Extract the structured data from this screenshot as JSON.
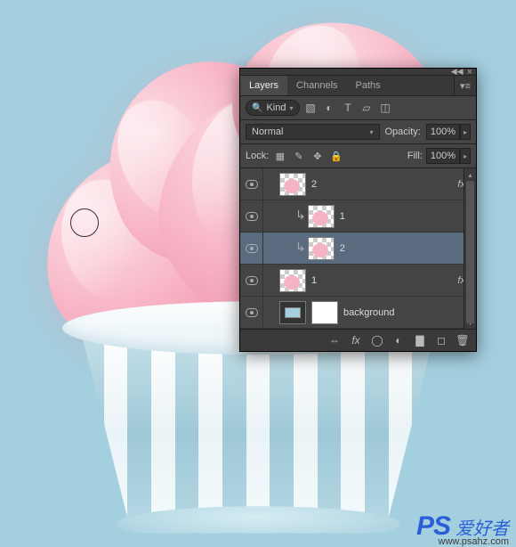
{
  "panel": {
    "tabs": [
      "Layers",
      "Channels",
      "Paths"
    ],
    "active_tab": 0,
    "filter": {
      "kind_label": "Kind",
      "icons": [
        "image-icon",
        "adjust-icon",
        "type-icon",
        "shape-icon",
        "smartobj-icon"
      ]
    },
    "blend": {
      "mode": "Normal",
      "opacity_label": "Opacity:",
      "opacity_value": "100%"
    },
    "lock": {
      "label": "Lock:",
      "fill_label": "Fill:",
      "fill_value": "100%"
    },
    "layers": [
      {
        "name": "2",
        "indent": 1,
        "clip": false,
        "thumb": "checker-blob",
        "fx": true,
        "selected": false
      },
      {
        "name": "1",
        "indent": 2,
        "clip": true,
        "thumb": "checker-blob",
        "fx": false,
        "selected": false
      },
      {
        "name": "2",
        "indent": 2,
        "clip": true,
        "thumb": "checker-blob",
        "fx": false,
        "selected": true
      },
      {
        "name": "1",
        "indent": 1,
        "clip": false,
        "thumb": "checker-blob",
        "fx": true,
        "selected": false
      },
      {
        "name": "background",
        "indent": 1,
        "clip": false,
        "thumb": "solid-mask",
        "fx": false,
        "selected": false
      }
    ],
    "footer_icons": [
      "link-icon",
      "fx-icon",
      "mask-icon",
      "adjustment-icon",
      "group-icon",
      "new-icon",
      "trash-icon"
    ]
  },
  "watermark": {
    "logo": "PS",
    "cn": "爱好者",
    "url": "www.psahz.com"
  }
}
